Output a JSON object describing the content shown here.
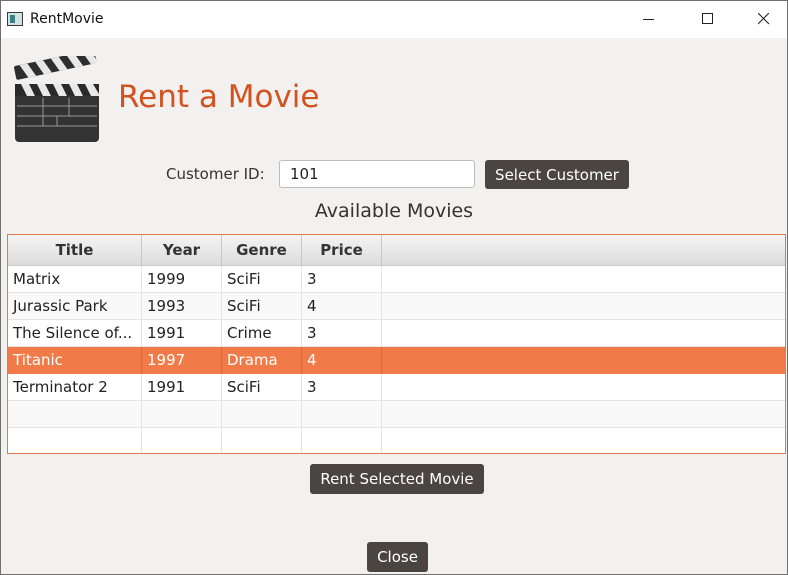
{
  "window": {
    "title": "RentMovie"
  },
  "header": {
    "title": "Rent a Movie"
  },
  "customer": {
    "label": "Customer ID:",
    "value": "101",
    "select_button": "Select Customer"
  },
  "movies": {
    "section_title": "Available Movies",
    "columns": [
      "Title",
      "Year",
      "Genre",
      "Price"
    ],
    "rows": [
      [
        "Matrix",
        "1999",
        "SciFi",
        "3"
      ],
      [
        "Jurassic Park",
        "1993",
        "SciFi",
        "4"
      ],
      [
        "The Silence of...",
        "1991",
        "Crime",
        "3"
      ],
      [
        "Titanic",
        "1997",
        "Drama",
        "4"
      ],
      [
        "Terminator 2",
        "1991",
        "SciFi",
        "3"
      ]
    ],
    "selected_index": 3
  },
  "actions": {
    "rent_button": "Rent Selected Movie",
    "close_button": "Close"
  },
  "colors": {
    "accent": "#d3521f",
    "selection": "#f07a48",
    "button": "#4a4540"
  }
}
